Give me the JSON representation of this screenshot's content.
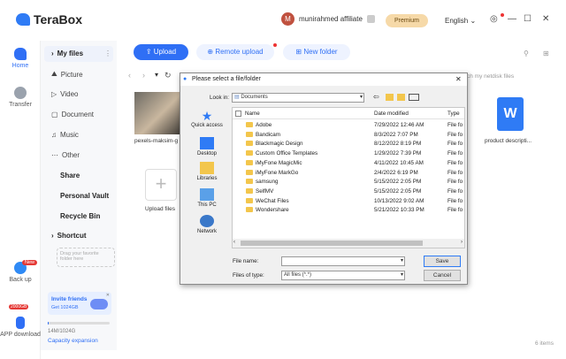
{
  "app": {
    "name": "TeraBox",
    "user": "munirahmed affiliate",
    "premium_label": "Premium",
    "language": "English",
    "colors": {
      "accent": "#2f6ff5",
      "premium": "#f6d9a8"
    }
  },
  "rail": {
    "home": "Home",
    "transfer": "Transfer",
    "backup": "Back up",
    "backup_badge": "New",
    "app_badge": "2000GB",
    "app_download": "APP download"
  },
  "sidebar": {
    "my_files": "My files",
    "picture": "Picture",
    "video": "Video",
    "document": "Document",
    "music": "Music",
    "other": "Other",
    "share": "Share",
    "personal_vault": "Personal Vault",
    "recycle_bin": "Recycle Bin",
    "shortcut": "Shortcut",
    "drag_hint": "Drag your favorite folder here",
    "invite_title": "Invite friends",
    "invite_sub": "Get 1024GB",
    "storage": "14M/1024G",
    "capacity": "Capacity expansion"
  },
  "toolbar": {
    "upload": "Upload",
    "remote_upload": "Remote upload",
    "new_folder": "New folder",
    "search_placeholder": "ch my netdisk files"
  },
  "main": {
    "file1": "pexels-maksim-g",
    "upload_files": "Upload files",
    "file3": "product descripti...",
    "count": "6 items"
  },
  "dialog": {
    "title": "Please select a file/folder",
    "look_in_label": "Look in:",
    "look_in_value": "Documents",
    "nav": [
      "Quick access",
      "Desktop",
      "Libraries",
      "This PC",
      "Network"
    ],
    "columns": {
      "name": "Name",
      "date": "Date modified",
      "type": "Type"
    },
    "rows": [
      {
        "name": "Adobe",
        "date": "7/29/2022 12:46 AM",
        "type": "File fo"
      },
      {
        "name": "Bandicam",
        "date": "8/3/2022 7:07 PM",
        "type": "File fo"
      },
      {
        "name": "Blackmagic Design",
        "date": "8/12/2022 8:19 PM",
        "type": "File fo"
      },
      {
        "name": "Custom Office Templates",
        "date": "1/29/2022 7:39 PM",
        "type": "File fo"
      },
      {
        "name": "iMyFone MagicMic",
        "date": "4/11/2022 10:45 AM",
        "type": "File fo"
      },
      {
        "name": "iMyFone MarkGo",
        "date": "2/4/2022 6:19 PM",
        "type": "File fo"
      },
      {
        "name": "samsung",
        "date": "5/15/2022 2:05 PM",
        "type": "File fo"
      },
      {
        "name": "SelfMV",
        "date": "5/15/2022 2:05 PM",
        "type": "File fo"
      },
      {
        "name": "WeChat Files",
        "date": "10/13/2022 9:02 AM",
        "type": "File fo"
      },
      {
        "name": "Wondershare",
        "date": "5/21/2022 10:33 PM",
        "type": "File fo"
      }
    ],
    "file_name_label": "File name:",
    "file_name_value": "",
    "file_type_label": "Files of type:",
    "file_type_value": "All files (*.*)",
    "save": "Save",
    "cancel": "Cancel"
  }
}
